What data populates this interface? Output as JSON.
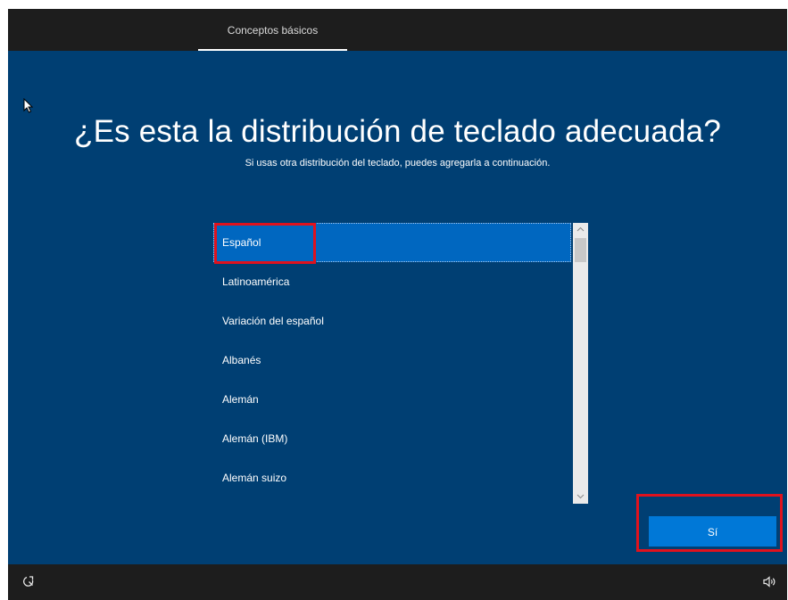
{
  "header": {
    "tab_label": "Conceptos básicos"
  },
  "main": {
    "title": "¿Es esta la distribución de teclado adecuada?",
    "subtitle": "Si usas otra distribución del teclado, puedes agregarla a continuación."
  },
  "keyboard_list": {
    "items": [
      {
        "label": "Español",
        "selected": true
      },
      {
        "label": "Latinoamérica",
        "selected": false
      },
      {
        "label": "Variación del español",
        "selected": false
      },
      {
        "label": "Albanés",
        "selected": false
      },
      {
        "label": "Alemán",
        "selected": false
      },
      {
        "label": "Alemán (IBM)",
        "selected": false
      },
      {
        "label": "Alemán suizo",
        "selected": false
      }
    ],
    "scroll_up_glyph": "^",
    "scroll_down_glyph": "v"
  },
  "footer": {
    "yes_label": "Sí"
  },
  "icons": {
    "cursor": "mouse-pointer-icon",
    "accessibility": "accessibility-icon",
    "volume": "volume-icon"
  },
  "colors": {
    "background": "#003f73",
    "selected_item": "#0067c0",
    "button": "#0078d7",
    "annotation": "#e0121d",
    "bar": "#1d1d1d"
  }
}
